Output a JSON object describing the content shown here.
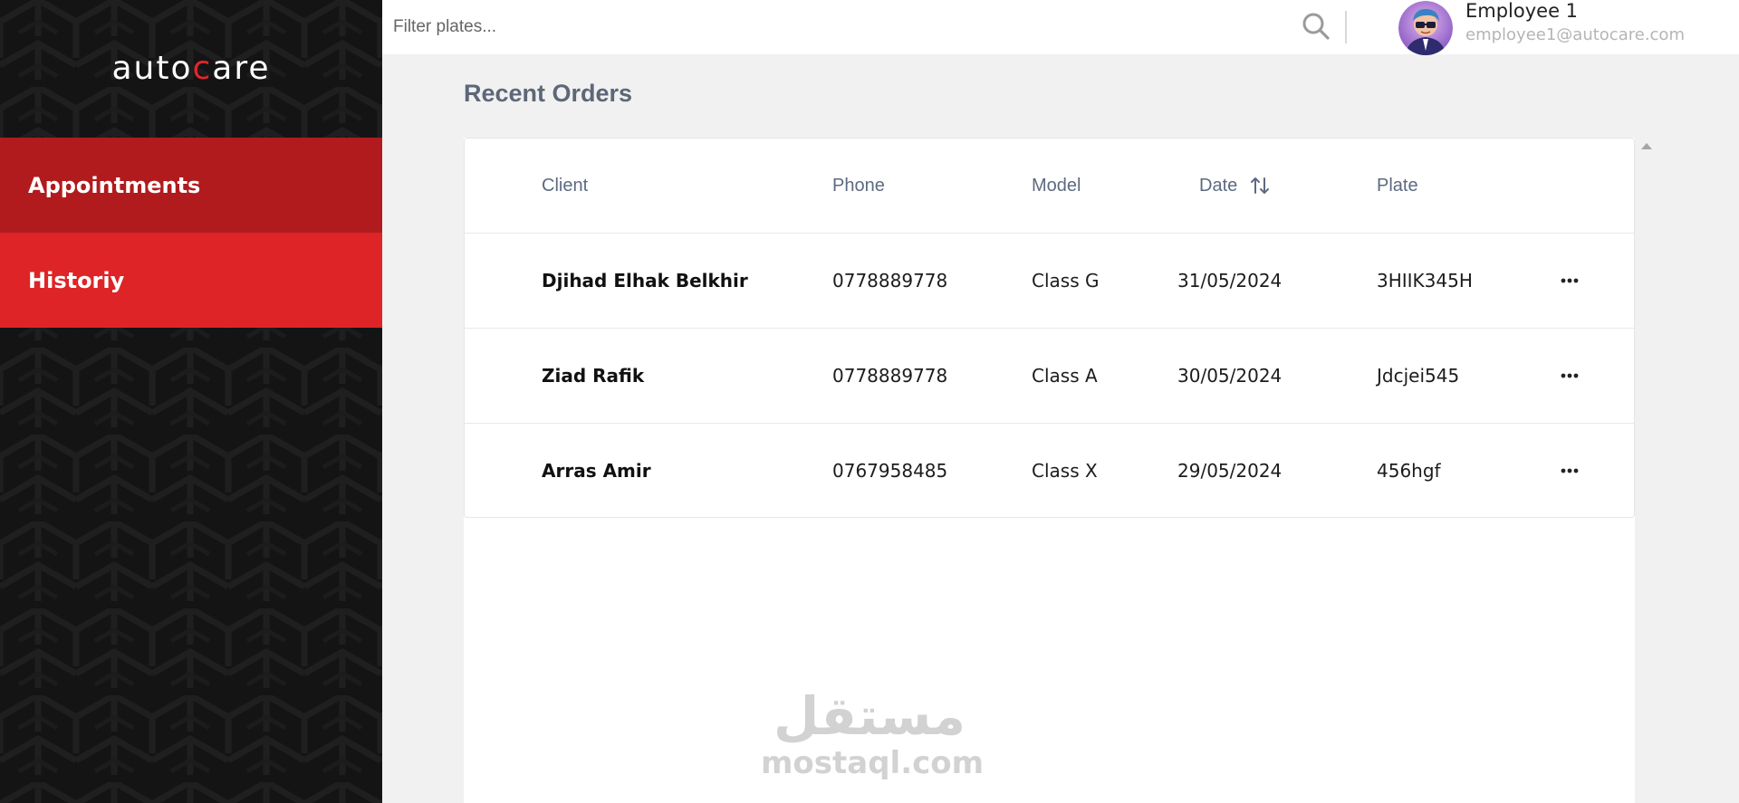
{
  "sidebar": {
    "logo": {
      "left": "auto",
      "accent": "c",
      "right": "are"
    },
    "items": [
      {
        "label": "Appointments"
      },
      {
        "label": "Historiy"
      }
    ]
  },
  "topbar": {
    "filter_placeholder": "Filter plates...",
    "user": {
      "name": "Employee 1",
      "email": "employee1@autocare.com"
    }
  },
  "main": {
    "title": "Recent Orders",
    "table": {
      "columns": [
        "Client",
        "Phone",
        "Model",
        "Date",
        "Plate"
      ],
      "rows": [
        {
          "client": "Djihad Elhak Belkhir",
          "phone": "0778889778",
          "model": "Class G",
          "date": "31/05/2024",
          "plate": "3HIIK345H"
        },
        {
          "client": "Ziad Rafik",
          "phone": "0778889778",
          "model": "Class A",
          "date": "30/05/2024",
          "plate": "Jdcjei545"
        },
        {
          "client": "Arras Amir",
          "phone": "0767958485",
          "model": "Class X",
          "date": "29/05/2024",
          "plate": "456hgf"
        }
      ]
    }
  },
  "watermark": {
    "arabic": "مستقل",
    "latin": "mostaql.com"
  },
  "colors": {
    "sidebar_bg": "#141414",
    "nav_active": "#b11b1d",
    "nav_item": "#de2426",
    "brand_accent": "#e1262a"
  },
  "icons": [
    "search-icon",
    "sort-arrows-icon",
    "more-horizontal-icon",
    "scroll-up-arrow-icon"
  ]
}
